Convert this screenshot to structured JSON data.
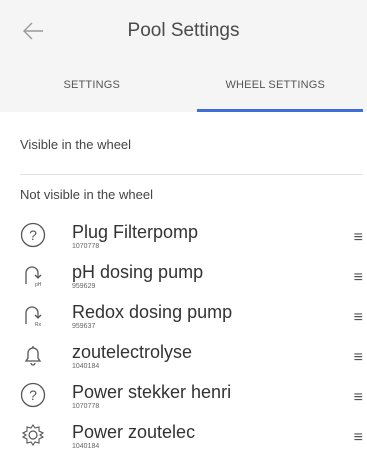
{
  "header": {
    "title": "Pool Settings",
    "back_icon": "back-arrow-icon"
  },
  "tabs": [
    {
      "label": "SETTINGS",
      "active": false
    },
    {
      "label": "WHEEL SETTINGS",
      "active": true
    }
  ],
  "accent_color": "#3f6fd6",
  "sections": {
    "visible_label": "Visible in the wheel",
    "hidden_label": "Not visible in the wheel"
  },
  "devices": [
    {
      "name": "Plug Filterpomp",
      "id": "1070778",
      "icon": "question-circle-icon"
    },
    {
      "name": "pH dosing pump",
      "id": "959629",
      "icon": "ph-pump-icon",
      "badge": "pH"
    },
    {
      "name": "Redox dosing pump",
      "id": "959637",
      "icon": "redox-pump-icon",
      "badge": "Rx"
    },
    {
      "name": "zoutelectrolyse",
      "id": "1040184",
      "icon": "bell-icon"
    },
    {
      "name": "Power stekker henri",
      "id": "1070778",
      "icon": "question-circle-icon"
    },
    {
      "name": "Power zoutelec",
      "id": "1040184",
      "icon": "gear-icon"
    }
  ],
  "drag_handle_icon": "drag-handle-icon"
}
